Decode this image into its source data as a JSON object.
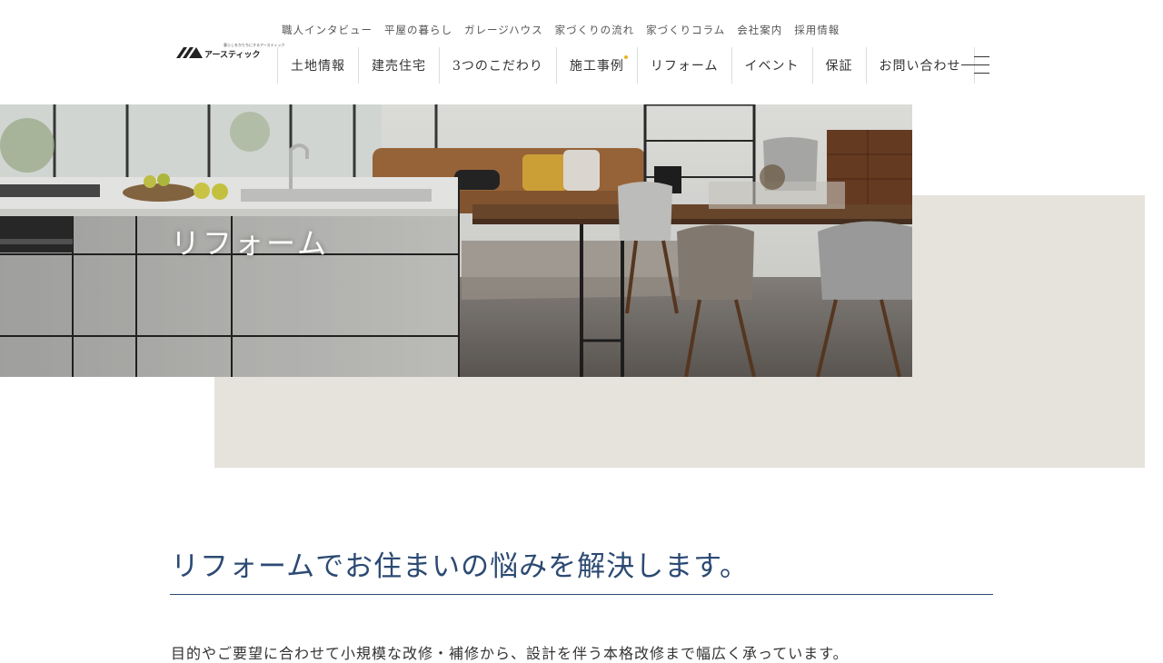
{
  "brand": {
    "tagline": "暮らしをかたちにするアースティック",
    "name": "アースティック"
  },
  "subnav": {
    "items": [
      "職人インタビュー",
      "平屋の暮らし",
      "ガレージハウス",
      "家づくりの流れ",
      "家づくりコラム",
      "会社案内",
      "採用情報"
    ]
  },
  "mainnav": {
    "items": [
      "土地情報",
      "建売住宅",
      "3つのこだわり",
      "施工事例",
      "リフォーム",
      "イベント",
      "保証",
      "お問い合わせ"
    ],
    "badge_color": "#e6b422"
  },
  "menu": {
    "icon": "hamburger-menu-icon"
  },
  "hero": {
    "title": "リフォーム"
  },
  "intro": {
    "heading": "リフォームでお住まいの悩みを解決します。",
    "text": "目的やご要望に合わせて小規模な改修・補修から、設計を伴う本格改修まで幅広く承っています。"
  },
  "colors": {
    "accent": "#2c4a73",
    "beige": "#e6e3dd"
  }
}
